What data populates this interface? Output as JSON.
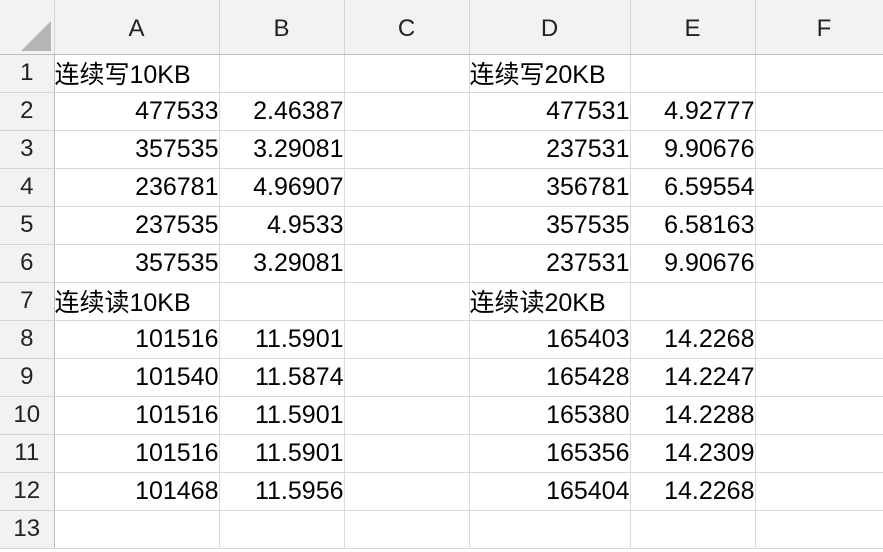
{
  "columns": [
    "A",
    "B",
    "C",
    "D",
    "E",
    "F"
  ],
  "rows": [
    {
      "n": "1",
      "A": "连续写10KB",
      "B": "",
      "C": "",
      "D": "连续写20KB",
      "E": "",
      "F": ""
    },
    {
      "n": "2",
      "A": "477533",
      "B": "2.46387",
      "C": "",
      "D": "477531",
      "E": "4.92777",
      "F": ""
    },
    {
      "n": "3",
      "A": "357535",
      "B": "3.29081",
      "C": "",
      "D": "237531",
      "E": "9.90676",
      "F": ""
    },
    {
      "n": "4",
      "A": "236781",
      "B": "4.96907",
      "C": "",
      "D": "356781",
      "E": "6.59554",
      "F": ""
    },
    {
      "n": "5",
      "A": "237535",
      "B": "4.9533",
      "C": "",
      "D": "357535",
      "E": "6.58163",
      "F": ""
    },
    {
      "n": "6",
      "A": "357535",
      "B": "3.29081",
      "C": "",
      "D": "237531",
      "E": "9.90676",
      "F": ""
    },
    {
      "n": "7",
      "A": "连续读10KB",
      "B": "",
      "C": "",
      "D": "连续读20KB",
      "E": "",
      "F": ""
    },
    {
      "n": "8",
      "A": "101516",
      "B": "11.5901",
      "C": "",
      "D": "165403",
      "E": "14.2268",
      "F": ""
    },
    {
      "n": "9",
      "A": "101540",
      "B": "11.5874",
      "C": "",
      "D": "165428",
      "E": "14.2247",
      "F": ""
    },
    {
      "n": "10",
      "A": "101516",
      "B": "11.5901",
      "C": "",
      "D": "165380",
      "E": "14.2288",
      "F": ""
    },
    {
      "n": "11",
      "A": "101516",
      "B": "11.5901",
      "C": "",
      "D": "165356",
      "E": "14.2309",
      "F": ""
    },
    {
      "n": "12",
      "A": "101468",
      "B": "11.5956",
      "C": "",
      "D": "165404",
      "E": "14.2268",
      "F": ""
    },
    {
      "n": "13",
      "A": "",
      "B": "",
      "C": "",
      "D": "",
      "E": "",
      "F": ""
    }
  ],
  "icons": {
    "corner": "select-all-triangle-icon"
  }
}
